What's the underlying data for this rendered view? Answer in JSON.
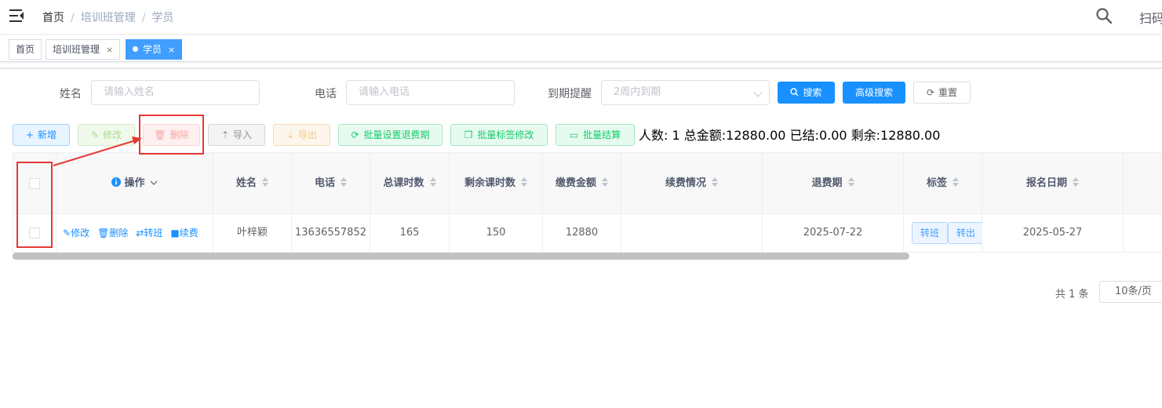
{
  "breadcrumb": [
    "首页",
    "培训班管理",
    "学员"
  ],
  "navbar": {
    "scan_label": "扫码"
  },
  "tags": [
    {
      "label": "首页",
      "closable": false,
      "active": false
    },
    {
      "label": "培训班管理",
      "closable": true,
      "active": false
    },
    {
      "label": "学员",
      "closable": true,
      "active": true
    }
  ],
  "tag_close_glyph": "×",
  "search": {
    "name_label": "姓名",
    "name_placeholder": "请输入姓名",
    "phone_label": "电话",
    "phone_placeholder": "请输入电话",
    "expire_label": "到期提醒",
    "expire_placeholder": "2周内到期",
    "search_button": "搜索",
    "advanced_button": "高级搜索",
    "reset_button": "重置"
  },
  "toolbar": {
    "add": "新增",
    "edit": "修改",
    "delete": "删除",
    "import": "导入",
    "export": "导出",
    "batch_refund_period": "批量设置退费期",
    "batch_tag_edit": "批量标签修改",
    "batch_settle": "批量结算"
  },
  "summary": "人数: 1 总金额:12880.00 已结:0.00 剩余:12880.00",
  "table": {
    "columns": {
      "ops": "操作",
      "name": "姓名",
      "phone": "电话",
      "total_hours": "总课时数",
      "remaining_hours": "剩余课时数",
      "amount": "缴费金额",
      "renewal": "续费情况",
      "refund_period": "退费期",
      "tags": "标签",
      "signup_date": "报名日期"
    },
    "row_actions": {
      "edit": "修改",
      "delete": "删除",
      "transfer": "转班",
      "renew": "续费"
    },
    "rows": [
      {
        "name": "叶梓颖",
        "phone": "13636557852",
        "total_hours": "165",
        "remaining_hours": "150",
        "amount": "12880",
        "renewal": "",
        "refund_period": "2025-07-22",
        "tag_transfer": "转班",
        "tag_out": "转出",
        "signup_date": "2025-05-27"
      }
    ]
  },
  "pagination": {
    "total": "共 1 条",
    "page_size": "10条/页"
  },
  "colors": {
    "primary": "#1890ff",
    "annotation": "#e53935"
  }
}
